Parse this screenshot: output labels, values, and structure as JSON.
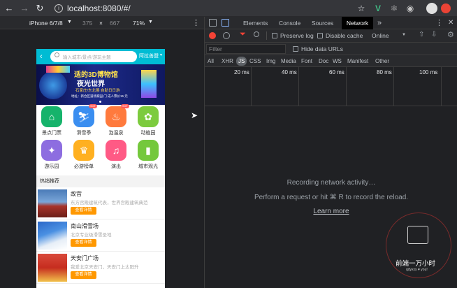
{
  "browser": {
    "url": "localhost:8080/#/"
  },
  "device_toolbar": {
    "device": "iPhone 6/7/8",
    "width": "375",
    "separator": "×",
    "height": "667",
    "zoom": "71%"
  },
  "phone": {
    "search_placeholder": "输入城市/景点/游玩主题",
    "city_button": "阿拉善盟",
    "banner": {
      "line1": "适的3D博物馆",
      "line2": "夜光世界",
      "line3": "石家庄/东北展 自助日日游",
      "line4": "地址：新合区道场家园 门 成人票价15 元"
    },
    "categories": [
      {
        "label": "景点门票",
        "color": "#16b36b",
        "glyph": "⌂",
        "hot": false
      },
      {
        "label": "滑雪季",
        "color": "#3a8ef0",
        "glyph": "⛷",
        "hot": true
      },
      {
        "label": "泡温泉",
        "color": "#ff7a3d",
        "glyph": "♨",
        "hot": true
      },
      {
        "label": "动植园",
        "color": "#7ccb3e",
        "glyph": "✿",
        "hot": false
      },
      {
        "label": "游乐园",
        "color": "#8d6de0",
        "glyph": "✦",
        "hot": false
      },
      {
        "label": "必游榜单",
        "color": "#ffb020",
        "glyph": "♛",
        "hot": false
      },
      {
        "label": "演出",
        "color": "#ff5a85",
        "glyph": "♫",
        "hot": false
      },
      {
        "label": "城市观光",
        "color": "#74c83c",
        "glyph": "▮",
        "hot": false
      }
    ],
    "hot_badge": "HOT",
    "hot_title": "热销推荐",
    "items": [
      {
        "title": "故宫",
        "desc": "东方宫殿建筑代表，世界宫殿建筑典范",
        "button": "查看详情"
      },
      {
        "title": "南山滑雪场",
        "desc": "北京专业级滑雪圣地",
        "button": "查看详情"
      },
      {
        "title": "天安门广场",
        "desc": "我爱北京天安门，天安门上太阳升",
        "button": "查看详情"
      }
    ]
  },
  "devtools": {
    "tabs": [
      "Elements",
      "Console",
      "Sources",
      "Network"
    ],
    "active_tab": "Network",
    "more_tabs": "»",
    "preserve_log": "Preserve log",
    "disable_cache": "Disable cache",
    "throttle": "Online",
    "filter_placeholder": "Filter",
    "hide_data_urls": "Hide data URLs",
    "types": [
      "All",
      "XHR",
      "JS",
      "CSS",
      "Img",
      "Media",
      "Font",
      "Doc",
      "WS",
      "Manifest",
      "Other"
    ],
    "active_type": "JS",
    "ticks": [
      "20 ms",
      "40 ms",
      "60 ms",
      "80 ms",
      "100 ms"
    ],
    "recording": "Recording network activity…",
    "hint": "Perform a request or hit ⌘ R to record the reload.",
    "learn_more": "Learn more"
  },
  "watermark": {
    "title": "前端一万小时",
    "subtitle": "qdyxxs ♥ you!"
  },
  "colors": {
    "phone_header": "#00bcd4",
    "record_red": "#f44336",
    "filter_red": "#f44336",
    "active_tab_underline": "#8ab4f8",
    "button_orange": "#ff9800"
  }
}
